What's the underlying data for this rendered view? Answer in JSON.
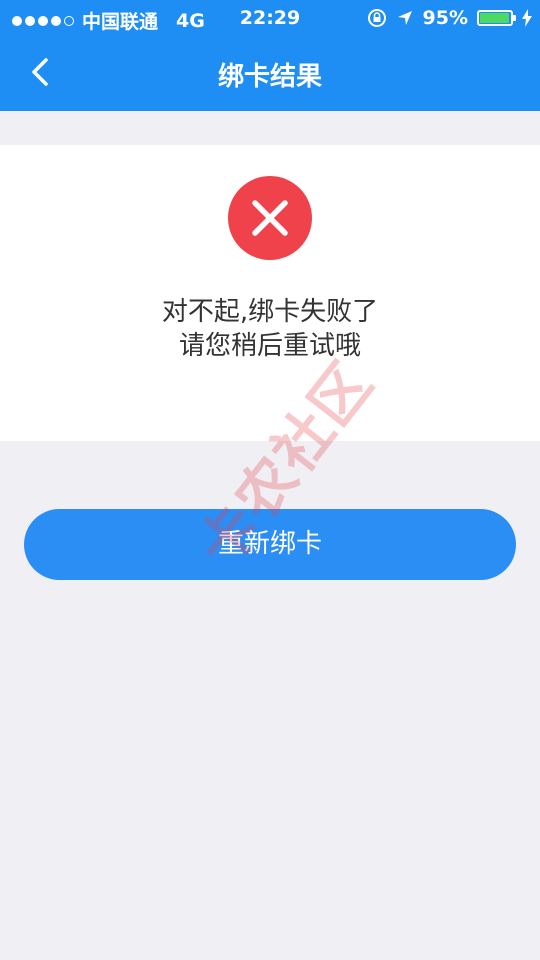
{
  "status_bar": {
    "carrier": "中国联通",
    "network": "4G",
    "time": "22:29",
    "battery_percent": "95%",
    "signal_bars_filled": 4,
    "signal_bars_total": 5
  },
  "nav": {
    "title": "绑卡结果",
    "back_icon": "chevron-left-icon"
  },
  "result": {
    "icon": "close-icon",
    "icon_color": "#f0424a",
    "line1": "对不起,绑卡失败了",
    "line2": "请您稍后重试哦"
  },
  "actions": {
    "retry_label": "重新绑卡"
  },
  "watermark": {
    "text": "卡农社区"
  },
  "colors": {
    "brand": "#1e8ef5",
    "button": "#2b8ef5",
    "background": "#efeff4",
    "error": "#f0424a",
    "battery": "#4cd964"
  }
}
